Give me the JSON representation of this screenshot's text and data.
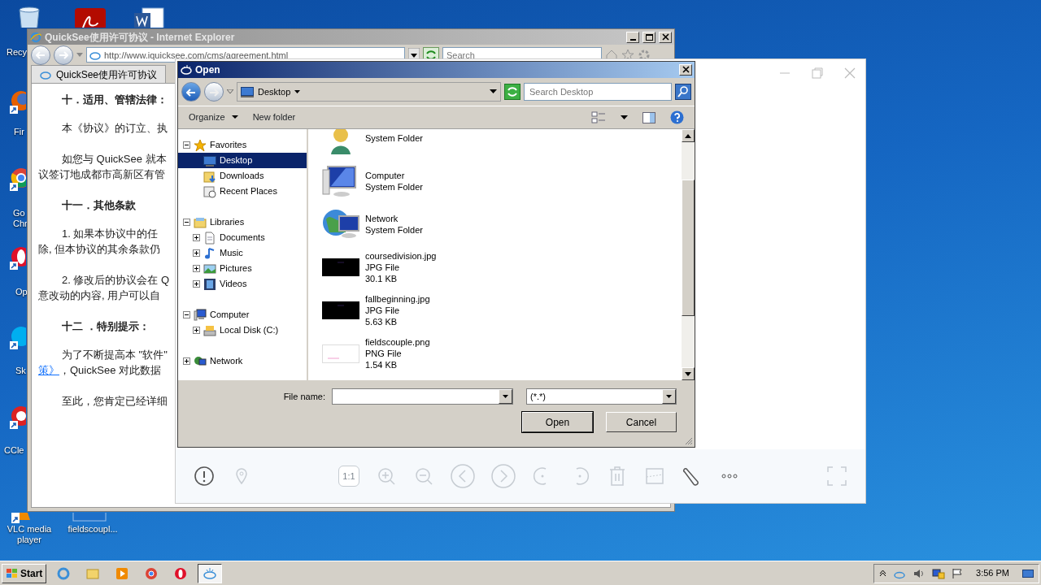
{
  "desktop_icons": [
    {
      "label": "Recy"
    },
    {
      "label": "Fir"
    },
    {
      "label": "Go Chr"
    },
    {
      "label": "Op"
    },
    {
      "label": "Sk"
    },
    {
      "label": "CCle"
    },
    {
      "label": "VLC media player"
    },
    {
      "label": "fieldscoupl..."
    }
  ],
  "ie_window": {
    "title": "QuickSee使用许可协议 - Internet Explorer",
    "address": "http://www.iquicksee.com/cms/agreement.html",
    "search": {
      "placeholder": "Search"
    },
    "tab": "QuickSee使用许可协议",
    "content": [
      {
        "kind": "heading",
        "lines": [
          "十．适用、管辖法律："
        ]
      },
      {
        "kind": "para",
        "lines": [
          "本《协议》的订立、执"
        ]
      },
      {
        "kind": "para",
        "lines": [
          "如您与 QuickSee 就本",
          "议签订地成都市高新区有管"
        ]
      },
      {
        "kind": "heading",
        "lines": [
          "十一．其他条款"
        ]
      },
      {
        "kind": "para",
        "lines": [
          "1. 如果本协议中的任",
          "除, 但本协议的其余条款仍"
        ]
      },
      {
        "kind": "para",
        "lines": [
          "2. 修改后的协议会在 Q",
          "意改动的内容, 用户可以自"
        ]
      },
      {
        "kind": "heading",
        "lines": [
          "十二 ．特别提示："
        ]
      },
      {
        "kind": "para",
        "lines": [
          "为了不断提高本 \"软件\""
        ],
        "link": "策》",
        "after_link": "，QuickSee 对此数据"
      },
      {
        "kind": "para",
        "lines": [
          "至此，您肯定已经详细"
        ]
      }
    ]
  },
  "viewer": {
    "zoom_label": "1:1",
    "tools": [
      {
        "disabled": false
      },
      {
        "disabled": true
      },
      {
        "disabled": true
      },
      {
        "disabled": true
      },
      {
        "disabled": true
      },
      {
        "disabled": true
      },
      {
        "disabled": true
      },
      {
        "disabled": true
      },
      {
        "disabled": true
      },
      {
        "disabled": true
      },
      {
        "disabled": true
      },
      {
        "disabled": false
      },
      {
        "disabled": false
      },
      {
        "disabled": true
      }
    ]
  },
  "open_dialog": {
    "title": "Open",
    "location": "Desktop",
    "search": {
      "placeholder": "Search Desktop"
    },
    "toolbar": [
      "Organize",
      "New folder"
    ],
    "tree": [
      {
        "label": "Favorites",
        "expanded": true,
        "selected": false,
        "children": [
          {
            "label": "Desktop",
            "selected": true
          },
          {
            "label": "Downloads",
            "selected": false
          },
          {
            "label": "Recent Places",
            "selected": false
          }
        ]
      },
      {
        "label": "Libraries",
        "expanded": true,
        "selected": false,
        "children": [
          {
            "label": "Documents",
            "expanded": false,
            "selected": false
          },
          {
            "label": "Music",
            "expanded": false,
            "selected": false
          },
          {
            "label": "Pictures",
            "expanded": false,
            "selected": false
          },
          {
            "label": "Videos",
            "expanded": false,
            "selected": false
          }
        ]
      },
      {
        "label": "Computer",
        "expanded": true,
        "selected": false,
        "children": [
          {
            "label": "Local Disk (C:)",
            "expanded": false,
            "selected": false
          }
        ]
      },
      {
        "label": "Network",
        "expanded": false,
        "selected": false
      }
    ],
    "files": [
      {
        "kind": "folder",
        "lines": [
          "System Folder"
        ]
      },
      {
        "kind": "folder",
        "lines": [
          "Computer",
          "System Folder"
        ]
      },
      {
        "kind": "folder",
        "lines": [
          "Network",
          "System Folder"
        ]
      },
      {
        "kind": "image",
        "lines": [
          "coursedivision.jpg",
          "JPG File",
          "30.1 KB"
        ]
      },
      {
        "kind": "image",
        "lines": [
          "fallbeginning.jpg",
          "JPG File",
          "5.63 KB"
        ]
      },
      {
        "kind": "image",
        "lines": [
          "fieldscouple.png",
          "PNG File",
          "1.54 KB"
        ]
      }
    ],
    "file_name_label": "File name:",
    "filter": "(*.*)",
    "buttons": [
      "Open",
      "Cancel"
    ]
  },
  "taskbar": {
    "start": "Start",
    "tasks": [
      {
        "selected": false
      },
      {
        "selected": false
      },
      {
        "selected": false
      },
      {
        "selected": false
      },
      {
        "selected": false
      },
      {
        "selected": true
      }
    ],
    "time": "3:56 PM"
  }
}
